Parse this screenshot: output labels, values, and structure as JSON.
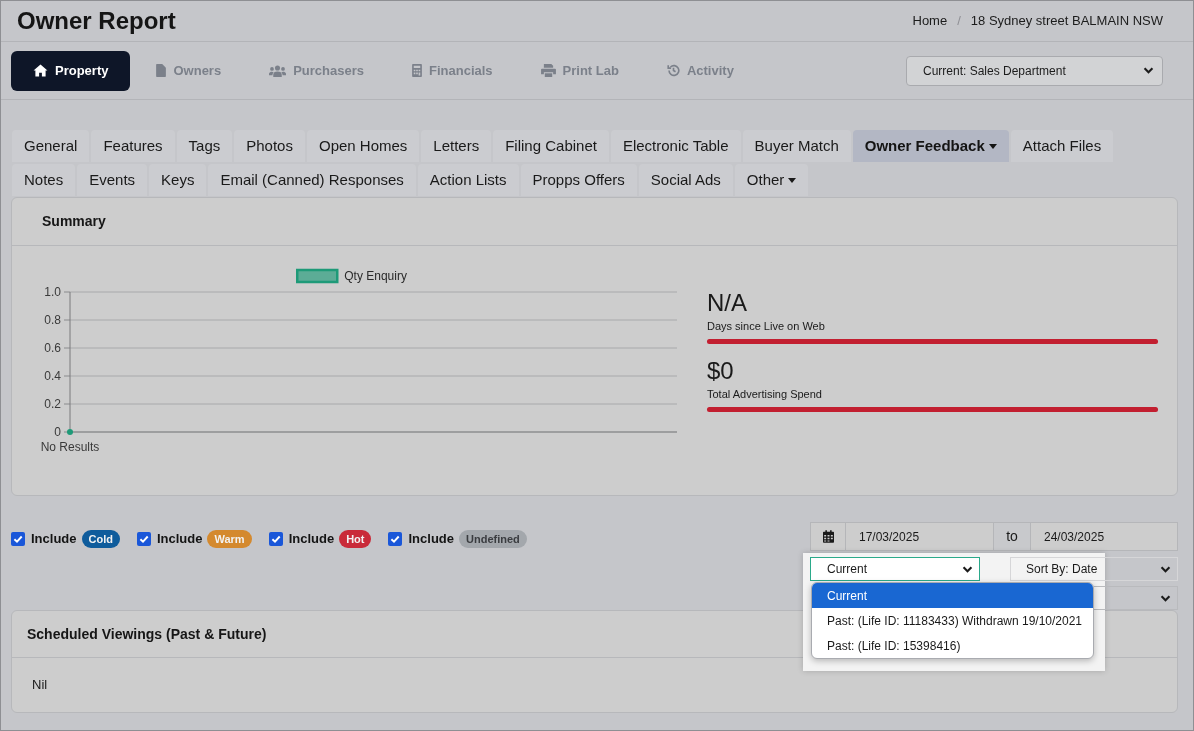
{
  "page": {
    "title": "Owner Report"
  },
  "breadcrumb": [
    {
      "kind": "link",
      "label": "Home"
    },
    {
      "kind": "separator",
      "label": "/"
    },
    {
      "kind": "current",
      "label": "18 Sydney street BALMAIN NSW"
    }
  ],
  "nav": [
    {
      "label": "Property",
      "selected": true
    },
    {
      "label": "Owners",
      "selected": false
    },
    {
      "label": "Purchasers",
      "selected": false
    },
    {
      "label": "Financials",
      "selected": false
    },
    {
      "label": "Print Lab",
      "selected": false
    },
    {
      "label": "Activity",
      "selected": false
    }
  ],
  "department_select": {
    "value": "Current: Sales Department"
  },
  "tabs": [
    {
      "label": "General",
      "selected": false,
      "has_menu": false
    },
    {
      "label": "Features",
      "selected": false,
      "has_menu": false
    },
    {
      "label": "Tags",
      "selected": false,
      "has_menu": false
    },
    {
      "label": "Photos",
      "selected": false,
      "has_menu": false
    },
    {
      "label": "Open Homes",
      "selected": false,
      "has_menu": false
    },
    {
      "label": "Letters",
      "selected": false,
      "has_menu": false
    },
    {
      "label": "Filing Cabinet",
      "selected": false,
      "has_menu": false
    },
    {
      "label": "Electronic Table",
      "selected": false,
      "has_menu": false
    },
    {
      "label": "Buyer Match",
      "selected": false,
      "has_menu": false
    },
    {
      "label": "Owner Feedback",
      "selected": true,
      "has_menu": true
    },
    {
      "label": "Attach Files",
      "selected": false,
      "has_menu": false
    },
    {
      "label": "Notes",
      "selected": false,
      "has_menu": false
    },
    {
      "label": "Events",
      "selected": false,
      "has_menu": false
    },
    {
      "label": "Keys",
      "selected": false,
      "has_menu": false
    },
    {
      "label": "Email (Canned) Responses",
      "selected": false,
      "has_menu": false
    },
    {
      "label": "Action Lists",
      "selected": false,
      "has_menu": false
    },
    {
      "label": "Propps Offers",
      "selected": false,
      "has_menu": false
    },
    {
      "label": "Social Ads",
      "selected": false,
      "has_menu": false
    },
    {
      "label": "Other",
      "selected": false,
      "has_menu": true
    }
  ],
  "summary": {
    "title": "Summary",
    "chart_data": {
      "type": "line",
      "categories": [
        "No Results"
      ],
      "series": [
        {
          "name": "Qty Enquiry",
          "color": "#1e9a78",
          "values": [
            0
          ],
          "marker": "circle"
        }
      ],
      "ylim": [
        0,
        1
      ],
      "yticks": [
        0,
        0.2,
        0.4,
        0.6,
        0.8,
        {
          "value": 1,
          "label": "1.0"
        }
      ],
      "grid": true
    },
    "stats": [
      {
        "value": "N/A",
        "label": "Days since Live on Web",
        "level": 1
      },
      {
        "value": "$0",
        "label": "Total Advertising Spend",
        "level": 1
      }
    ]
  },
  "filters": {
    "includes": [
      {
        "label": "Include",
        "badge": "Cold",
        "color": "#0f5c9c",
        "checked": true
      },
      {
        "label": "Include",
        "badge": "Warm",
        "color": "#d4892e",
        "checked": true
      },
      {
        "label": "Include",
        "badge": "Hot",
        "color": "#c92a39",
        "checked": true
      },
      {
        "label": "Include",
        "badge": "Undefined",
        "color": "#a3a7ac",
        "checked": true
      }
    ],
    "date_range": {
      "from": "17/03/2025",
      "separator": "to",
      "to": "24/03/2025"
    },
    "life_select": {
      "value": "Current",
      "open": true,
      "options": [
        {
          "label": "Current",
          "selected": true
        },
        {
          "label": "Past: (Life ID: 11183433) Withdrawn 19/10/2021",
          "selected": false
        },
        {
          "label": "Past: (Life ID: 15398416)",
          "selected": false
        }
      ]
    },
    "sort_select": {
      "value": "Sort By: Date"
    }
  },
  "scheduled_viewings": {
    "title": "Scheduled Viewings (Past & Future)",
    "body": "Nil"
  }
}
